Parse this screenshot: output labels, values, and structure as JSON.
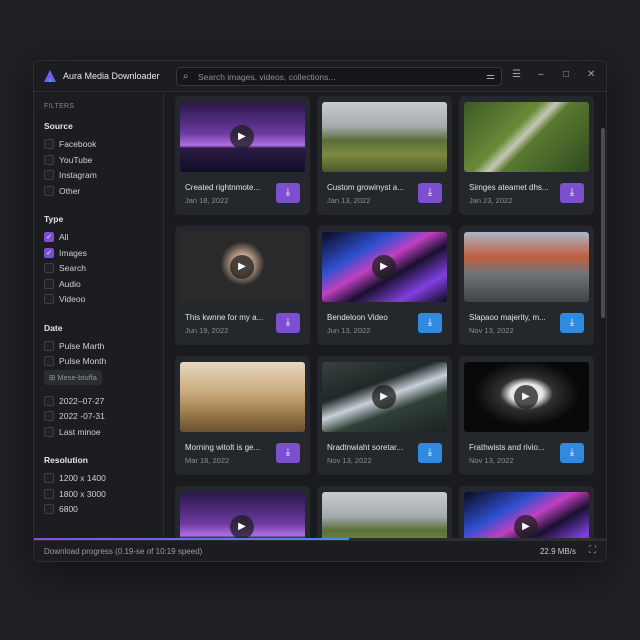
{
  "app": {
    "title": "Aura Media Downloader",
    "search_placeholder": "Search images, videos, collections...",
    "icons": [
      "logo",
      "search-icon",
      "sliders-icon",
      "filter-icon",
      "minimize-icon",
      "maximize-icon",
      "close-icon"
    ]
  },
  "sidebar": {
    "heading": "FILTERS",
    "source": {
      "label": "Source",
      "items": [
        {
          "label": "Facebook",
          "checked": false
        },
        {
          "label": "YouTube",
          "checked": false
        },
        {
          "label": "Instagram",
          "checked": false
        },
        {
          "label": "Other",
          "checked": false
        }
      ]
    },
    "type": {
      "label": "Type",
      "items": [
        {
          "label": "All",
          "checked": true
        },
        {
          "label": "Images",
          "checked": true
        },
        {
          "label": "Search",
          "checked": false
        },
        {
          "label": "Audio",
          "checked": false
        },
        {
          "label": "Videoo",
          "checked": false
        }
      ]
    },
    "date": {
      "label": "Date",
      "items": [
        {
          "label": "Pulse Marth",
          "checked": false
        },
        {
          "label": "Pulse Month",
          "checked": false
        }
      ],
      "chip": "⊞ Mese-btuffa",
      "items2": [
        {
          "label": "2022–07-27",
          "checked": false
        },
        {
          "label": "2022 -07-31",
          "checked": false
        },
        {
          "label": "Last minoe",
          "checked": false
        }
      ]
    },
    "resolution": {
      "label": "Resolution",
      "items": [
        {
          "label": "1200 x 1400",
          "checked": false
        },
        {
          "label": "1800 x 3000",
          "checked": false
        },
        {
          "label": "6800",
          "checked": false
        }
      ]
    }
  },
  "colors": {
    "purple": "#7b4fd0",
    "blue": "#2f8ae0"
  },
  "cards": [
    {
      "title": "Created rightnmote...",
      "date": "Jan 18, 2022",
      "video": true,
      "btn": "purple",
      "thumb": "purple-sunset"
    },
    {
      "title": "Custom growinyst a...",
      "date": "Jan 13, 2022",
      "video": false,
      "btn": "purple",
      "thumb": "green-hills"
    },
    {
      "title": "Simges ateamet dhs...",
      "date": "Jan 23, 2022",
      "video": false,
      "btn": "purple",
      "thumb": "aerial-road"
    },
    {
      "title": "This kwnne for my a...",
      "date": "Jun 19, 2022",
      "video": true,
      "btn": "purple",
      "thumb": "person-headphones"
    },
    {
      "title": "Bendeloon Video",
      "date": "Jun 13, 2022",
      "video": true,
      "btn": "blue",
      "thumb": "abstract-waves"
    },
    {
      "title": "Slapaoo majerity, m...",
      "date": "Nov 13, 2022",
      "video": false,
      "btn": "blue",
      "thumb": "mountains"
    },
    {
      "title": "Morning witolt is ge...",
      "date": "Mar 18, 2022",
      "video": false,
      "btn": "purple",
      "thumb": "woman-field"
    },
    {
      "title": "Nradtnwiaht soretar...",
      "date": "Nov 13, 2022",
      "video": true,
      "btn": "blue",
      "thumb": "river"
    },
    {
      "title": "Frathwists and rivio...",
      "date": "Nov 13, 2022",
      "video": true,
      "btn": "blue",
      "thumb": "mask"
    },
    {
      "title": "",
      "date": "",
      "video": true,
      "btn": "",
      "thumb": "purple-sunset"
    },
    {
      "title": "",
      "date": "",
      "video": false,
      "btn": "",
      "thumb": "green-hills"
    },
    {
      "title": "",
      "date": "",
      "video": true,
      "btn": "",
      "thumb": "abstract-waves"
    }
  ],
  "footer": {
    "status": "Download progress (0.19-se of 10:19 speed)",
    "speed": "22.9 MB/s",
    "progress_percent": 55
  }
}
